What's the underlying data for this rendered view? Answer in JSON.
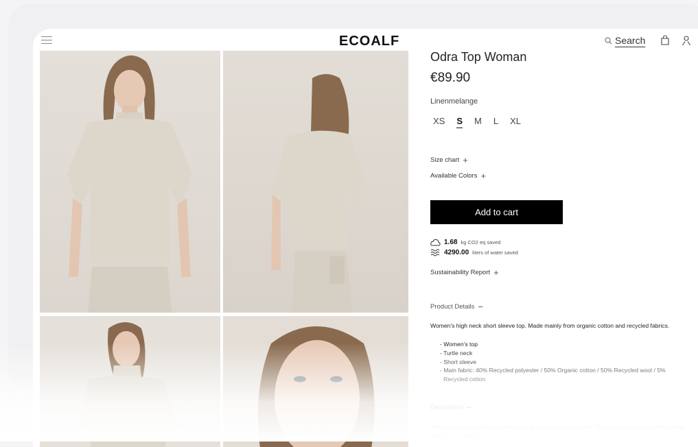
{
  "header": {
    "brand": "ECOALF",
    "search_label": "Search",
    "icons": [
      "hamburger-menu-icon",
      "search-icon",
      "bag-icon",
      "user-icon"
    ]
  },
  "product": {
    "title": "Odra Top Woman",
    "price": "€89.90",
    "color_name": "Linenmelange",
    "sizes": [
      "XS",
      "S",
      "M",
      "L",
      "XL"
    ],
    "selected_size": "S",
    "size_chart_label": "Size chart",
    "available_colors_label": "Available Colors",
    "add_to_cart_label": "Add to cart"
  },
  "sustainability": {
    "co2_value": "1.68",
    "co2_unit": "kg CO2 eq saved",
    "water_value": "4290.00",
    "water_unit": "liters of water saved",
    "report_label": "Sustainability Report"
  },
  "details": {
    "heading": "Product Details",
    "summary": "Women's high neck short sleeve top. Made mainly from organic cotton and recycled fabrics.",
    "bullets": [
      "- Women's top",
      "- Turtle neck",
      "- Short sleeve",
      "- Main fabric: 40% Recycled polyester / 50% Organic cotton / 50% Recycled wool / 5% Recycled cotton"
    ]
  },
  "description": {
    "heading": "Description",
    "text": "The organic cotton fabric makes this top soft and easy to wear. The recycled material of the fabric makes it sustainable."
  },
  "colors": {
    "accent": "#000000",
    "fabric": "#ddd7cb",
    "hair": "#8a6a4e",
    "skin": "#e6c9b5"
  }
}
